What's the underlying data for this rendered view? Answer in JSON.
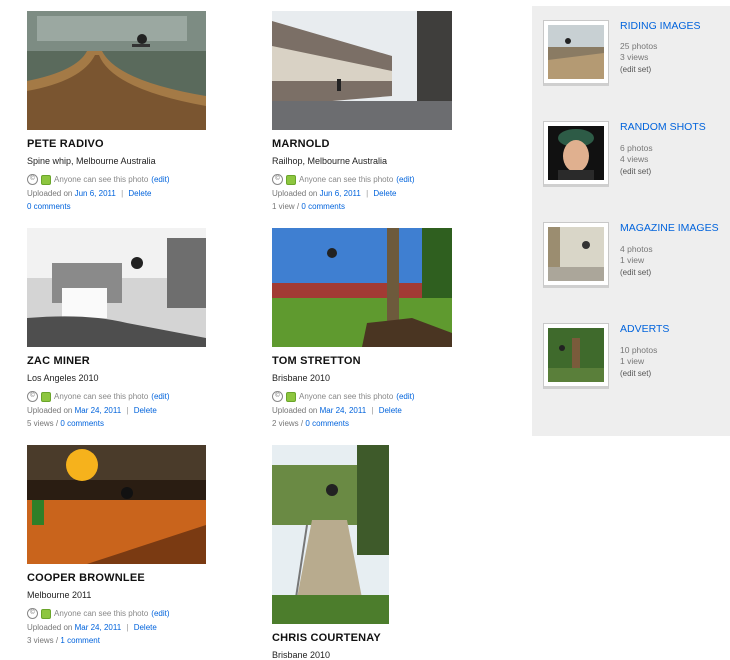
{
  "photos": [
    {
      "title": "PETE RADIVO",
      "description": "Spine whip, Melbourne Australia",
      "privacy_text": "Anyone can see this photo",
      "privacy_edit": "(edit)",
      "uploaded_prefix": "Uploaded on",
      "uploaded_date": "Jun 6, 2011",
      "delete": "Delete",
      "views": "",
      "comments": "0 comments",
      "thumb_scene": "ramp-indoor"
    },
    {
      "title": "MARNOLD",
      "description": "Railhop, Melbourne Australia",
      "privacy_text": "Anyone can see this photo",
      "privacy_edit": "(edit)",
      "uploaded_prefix": "Uploaded on",
      "uploaded_date": "Jun 6, 2011",
      "delete": "Delete",
      "views": "1 view",
      "comments": "0 comments",
      "thumb_scene": "street-building"
    },
    {
      "title": "ZAC MINER",
      "description": "Los Angeles 2010",
      "privacy_text": "Anyone can see this photo",
      "privacy_edit": "(edit)",
      "uploaded_prefix": "Uploaded on",
      "uploaded_date": "Mar 24, 2011",
      "delete": "Delete",
      "views": "5 views",
      "comments": "0 comments",
      "thumb_scene": "bw-street"
    },
    {
      "title": "TOM STRETTON",
      "description": "Brisbane 2010",
      "privacy_text": "Anyone can see this photo",
      "privacy_edit": "(edit)",
      "uploaded_prefix": "Uploaded on",
      "uploaded_date": "Mar 24, 2011",
      "delete": "Delete",
      "views": "2 views",
      "comments": "0 comments",
      "thumb_scene": "park-green"
    },
    {
      "title": "COOPER BROWNLEE",
      "description": "Melbourne 2011",
      "privacy_text": "Anyone can see this photo",
      "privacy_edit": "(edit)",
      "uploaded_prefix": "Uploaded on",
      "uploaded_date": "Mar 24, 2011",
      "delete": "Delete",
      "views": "3 views",
      "comments": "1 comment",
      "thumb_scene": "warehouse-orange"
    },
    {
      "title": "CHRIS COURTENAY",
      "description": "Brisbane 2010",
      "thumb_scene": "stairs-rail"
    }
  ],
  "sets": [
    {
      "title": "RIDING IMAGES",
      "photos": "25 photos",
      "views": "3 views",
      "edit": "(edit set)"
    },
    {
      "title": "RANDOM SHOTS",
      "photos": "6 photos",
      "views": "4 views",
      "edit": "(edit set)"
    },
    {
      "title": "MAGAZINE IMAGES",
      "photos": "4 photos",
      "views": "1 view",
      "edit": "(edit set)"
    },
    {
      "title": "ADVERTS",
      "photos": "10 photos",
      "views": "1 view",
      "edit": "(edit set)"
    }
  ]
}
